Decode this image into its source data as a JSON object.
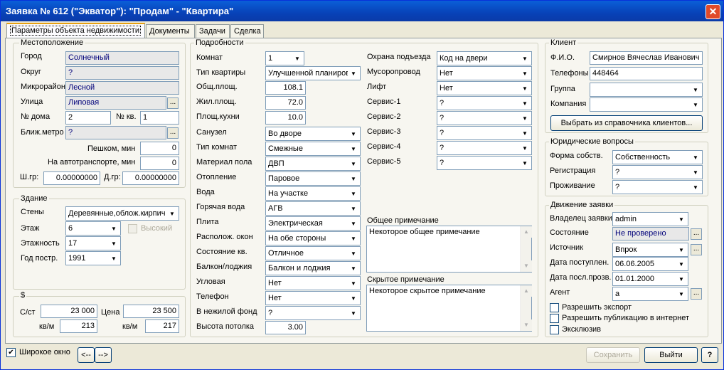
{
  "window": {
    "title": "Заявка № 612 (\"Экватор\"): \"Продам\" - \"Квартира\"",
    "close": "✕"
  },
  "tabs": [
    "Параметры объекта недвижимости",
    "Документы",
    "Задачи",
    "Сделка"
  ],
  "location": {
    "title": "Местоположение",
    "city_label": "Город",
    "city": "Солнечный",
    "district_label": "Округ",
    "district": "?",
    "microdistrict_label": "Микрорайон",
    "microdistrict": "Лесной",
    "street_label": "Улица",
    "street": "Липовая",
    "house_label": "№ дома",
    "house": "2",
    "apt_label": "№ кв.",
    "apt": "1",
    "metro_label": "Ближ.метро",
    "metro": "?",
    "walk_label": "Пешком, мин",
    "walk": "0",
    "transport_label": "На автотранспорте, мин",
    "transport": "0",
    "lat_label": "Ш.гр:",
    "lat": "0.00000000",
    "lon_label": "Д.гр:",
    "lon": "0.00000000"
  },
  "building": {
    "title": "Здание",
    "walls_label": "Стены",
    "walls": "Деревянные,облож.кирпич",
    "floor_label": "Этаж",
    "floor": "6",
    "tall_label": "Высокий",
    "floors_label": "Этажность",
    "floors": "17",
    "year_label": "Год постр.",
    "year": "1991"
  },
  "price": {
    "title": "$",
    "cost_label": "С/ст",
    "cost": "23 000",
    "price_label": "Цена",
    "price": "23 500",
    "sqm1_label": "кв/м",
    "sqm1": "213",
    "sqm2_label": "кв/м",
    "sqm2": "217"
  },
  "details": {
    "title": "Подробности",
    "rooms_label": "Комнат",
    "rooms": "1",
    "type_label": "Тип квартиры",
    "type": "Улучшенной планиров",
    "total_label": "Общ.площ.",
    "total": "108.1",
    "living_label": "Жил.площ.",
    "living": "72.0",
    "kitchen_label": "Площ.кухни",
    "kitchen": "10.0",
    "bath_label": "Санузел",
    "bath": "Во дворе",
    "roomtype_label": "Тип комнат",
    "roomtype": "Смежные",
    "floormat_label": "Материал пола",
    "floormat": "ДВП",
    "heating_label": "Отопление",
    "heating": "Паровое",
    "water_label": "Вода",
    "water": "На участке",
    "hotwater_label": "Горячая вода",
    "hotwater": "АГВ",
    "stove_label": "Плита",
    "stove": "Электрическая",
    "windows_label": "Располож. окон",
    "windows": "На обе стороны",
    "condition_label": "Состояние кв.",
    "condition": "Отличное",
    "balcony_label": "Балкон/лоджия",
    "balcony": "Балкон и лоджия",
    "corner_label": "Угловая",
    "corner": "Нет",
    "phone_label": "Телефон",
    "phone": "Нет",
    "nonres_label": "В нежилой фонд",
    "nonres": "?",
    "ceiling_label": "Высота потолка",
    "ceiling": "3.00",
    "guard_label": "Охрана подъезда",
    "guard": "Код на двери",
    "chute_label": "Мусоропровод",
    "chute": "Нет",
    "lift_label": "Лифт",
    "lift": "Нет",
    "s1_label": "Сервис-1",
    "s1": "?",
    "s2_label": "Сервис-2",
    "s2": "?",
    "s3_label": "Сервис-3",
    "s3": "?",
    "s4_label": "Сервис-4",
    "s4": "?",
    "s5_label": "Сервис-5",
    "s5": "?",
    "note_label": "Общее примечание",
    "note": "Некоторое общее примечание",
    "hidden_label": "Скрытое примечание",
    "hidden": "Некоторое скрытое примечание"
  },
  "client": {
    "title": "Клиент",
    "name_label": "Ф.И.О.",
    "name": "Смирнов Вячеслав Иванович",
    "phones_label": "Телефоны",
    "phones": "448464",
    "group_label": "Группа",
    "group": "",
    "company_label": "Компания",
    "company": "",
    "pick_button": "Выбрать из справочника клиентов..."
  },
  "legal": {
    "title": "Юридические вопросы",
    "own_label": "Форма собств.",
    "own": "Собственность",
    "reg_label": "Регистрация",
    "reg": "?",
    "live_label": "Проживание",
    "live": "?"
  },
  "flow": {
    "title": "Движение заявки",
    "owner_label": "Владелец заявки",
    "owner": "admin",
    "state_label": "Состояние",
    "state": "Не проверено",
    "source_label": "Источник",
    "source": "Впрок",
    "recv_label": "Дата поступлен.",
    "recv": "06.06.2005",
    "last_label": "Дата посл.прозв.",
    "last": "01.01.2000",
    "agent_label": "Агент",
    "agent": "a",
    "export_label": "Разрешить экспорт",
    "publish_label": "Разрешить публикацию в интернет",
    "exclusive_label": "Эксклюзив"
  },
  "footer": {
    "wide_label": "Широкое окно",
    "prev": "<--",
    "next": "-->",
    "save": "Сохранить",
    "exit": "Выйти",
    "help": "?"
  }
}
